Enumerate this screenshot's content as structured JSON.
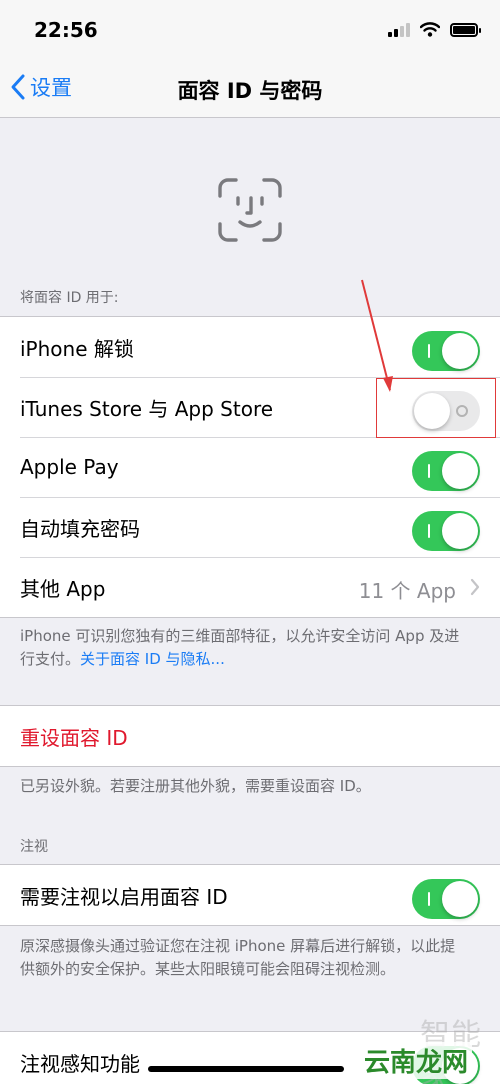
{
  "status_bar": {
    "time": "22:56"
  },
  "nav": {
    "back_label": "设置",
    "title": "面容 ID 与密码"
  },
  "use_for": {
    "header": "将面容 ID 用于:",
    "rows": [
      {
        "label": "iPhone 解锁",
        "on": true
      },
      {
        "label": "iTunes Store 与 App Store",
        "on": false
      },
      {
        "label": "Apple Pay",
        "on": true
      },
      {
        "label": "自动填充密码",
        "on": true
      },
      {
        "label": "其他 App",
        "value": "11 个 App"
      }
    ],
    "footer_text": "iPhone 可识别您独有的三维面部特征，以允许安全访问 App 及进行支付。",
    "footer_link": "关于面容 ID 与隐私..."
  },
  "reset": {
    "label": "重设面容 ID",
    "footer": "已另设外貌。若要注册其他外貌，需要重设面容 ID。"
  },
  "attention": {
    "header": "注视",
    "row_label": "需要注视以启用面容 ID",
    "row_on": true,
    "footer": "原深感摄像头通过验证您在注视 iPhone 屏幕后进行解锁，以此提供额外的安全保护。某些太阳眼镜可能会阻碍注视检测。",
    "aware_label": "注视感知功能"
  },
  "watermark": {
    "text": "智能家",
    "badge": "云南龙网"
  },
  "colors": {
    "accent": "#1a7cf5",
    "toggle_on": "#34c759",
    "destructive": "#e0182d",
    "annotation": "#e03a3a"
  },
  "icons": {
    "face_id": "faceid-icon",
    "back": "chevron-left-icon",
    "disclosure": "chevron-right-icon"
  }
}
